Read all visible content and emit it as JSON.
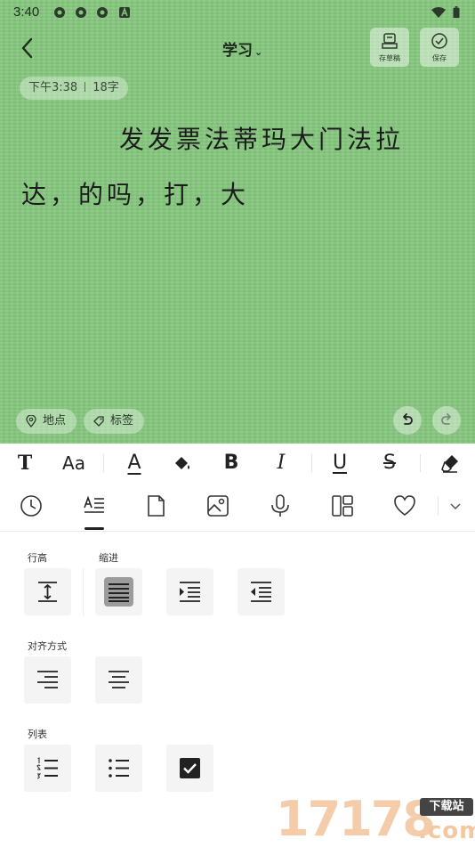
{
  "status_bar": {
    "time": "3:40"
  },
  "header": {
    "title": "学习",
    "draft_label": "存草稿",
    "save_label": "保存"
  },
  "note": {
    "meta_time": "下午3:38",
    "meta_count": "18字",
    "content": "发发票法蒂玛大门法拉达，的吗，打，大"
  },
  "footer_chips": {
    "location": "地点",
    "tag": "标签"
  },
  "format_toolbar": {
    "text_style": "T",
    "font_size": "Aa",
    "font_color": "A",
    "bold": "B",
    "italic": "I",
    "underline": "U",
    "strikethrough": "S"
  },
  "panel": {
    "line_height_label": "行高",
    "indent_label": "缩进",
    "align_label": "对齐方式",
    "list_label": "列表"
  },
  "watermark": {
    "number": "17178",
    "badge": "下载站",
    "domain": ".com"
  },
  "colors": {
    "editor_bg": "#85c77e",
    "toolbar_bg": "#ffffff",
    "button_bg": "#f4f4f4"
  }
}
